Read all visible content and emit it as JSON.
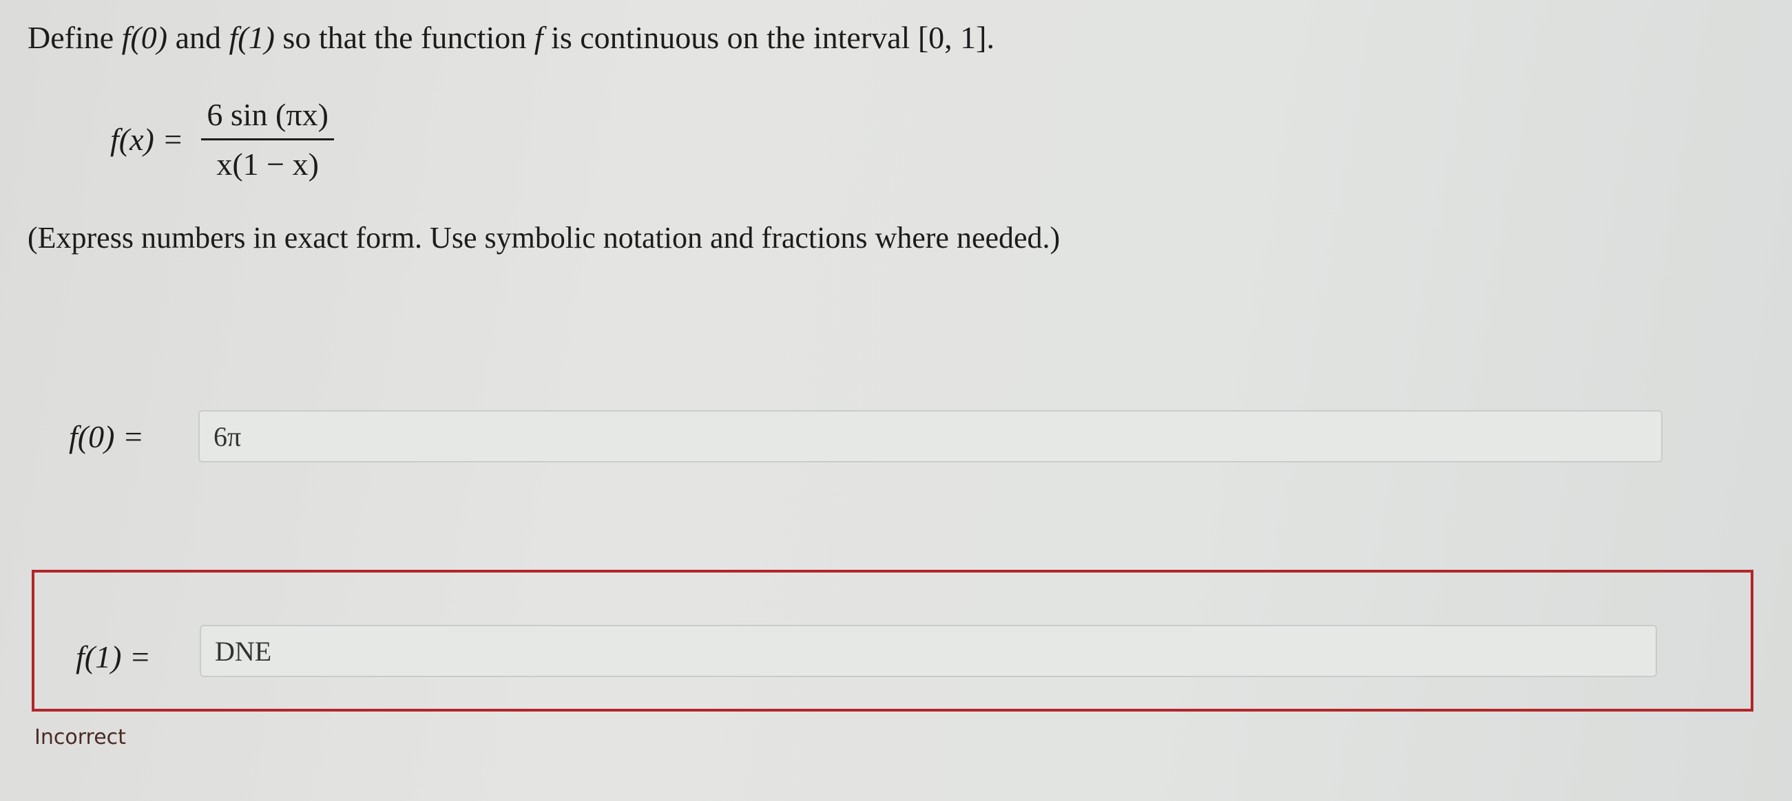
{
  "question": {
    "prefix": "Define ",
    "f0": "f(0)",
    "and": " and ",
    "f1": "f(1)",
    "middle": " so that the function ",
    "f": "f",
    "suffix": " is continuous on the interval [0, 1]."
  },
  "formula": {
    "lhs": "f(x) =",
    "numerator": "6 sin (πx)",
    "denominator": "x(1 − x)"
  },
  "instructions": "(Express numbers in exact form. Use symbolic notation and fractions where needed.)",
  "answers": [
    {
      "label": "f(0) =",
      "value": "6π"
    },
    {
      "label": "f(1) =",
      "value": "DNE"
    }
  ],
  "feedback": "Incorrect",
  "colors": {
    "error_border": "#b3252a"
  }
}
